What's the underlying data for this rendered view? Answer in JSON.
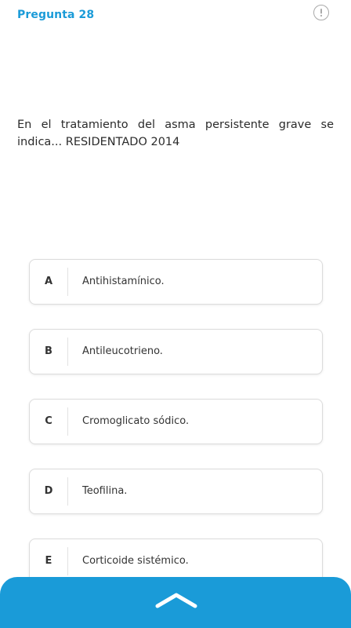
{
  "header": {
    "question_title": "Pregunta 28",
    "report_icon": "exclamation-circle-icon"
  },
  "question": {
    "text": "En el tratamiento del asma persistente grave se indica... RESIDENTADO 2014"
  },
  "options": [
    {
      "letter": "A",
      "text": "Antihistamínico."
    },
    {
      "letter": "B",
      "text": "Antileucotrieno."
    },
    {
      "letter": "C",
      "text": "Cromoglicato sódico."
    },
    {
      "letter": "D",
      "text": "Teofilina."
    },
    {
      "letter": "E",
      "text": "Corticoide sistémico."
    }
  ],
  "bottom_bar": {
    "icon": "chevron-up-icon"
  },
  "colors": {
    "accent": "#1a9bd8",
    "text": "#333333",
    "border": "#dcdcdc"
  }
}
